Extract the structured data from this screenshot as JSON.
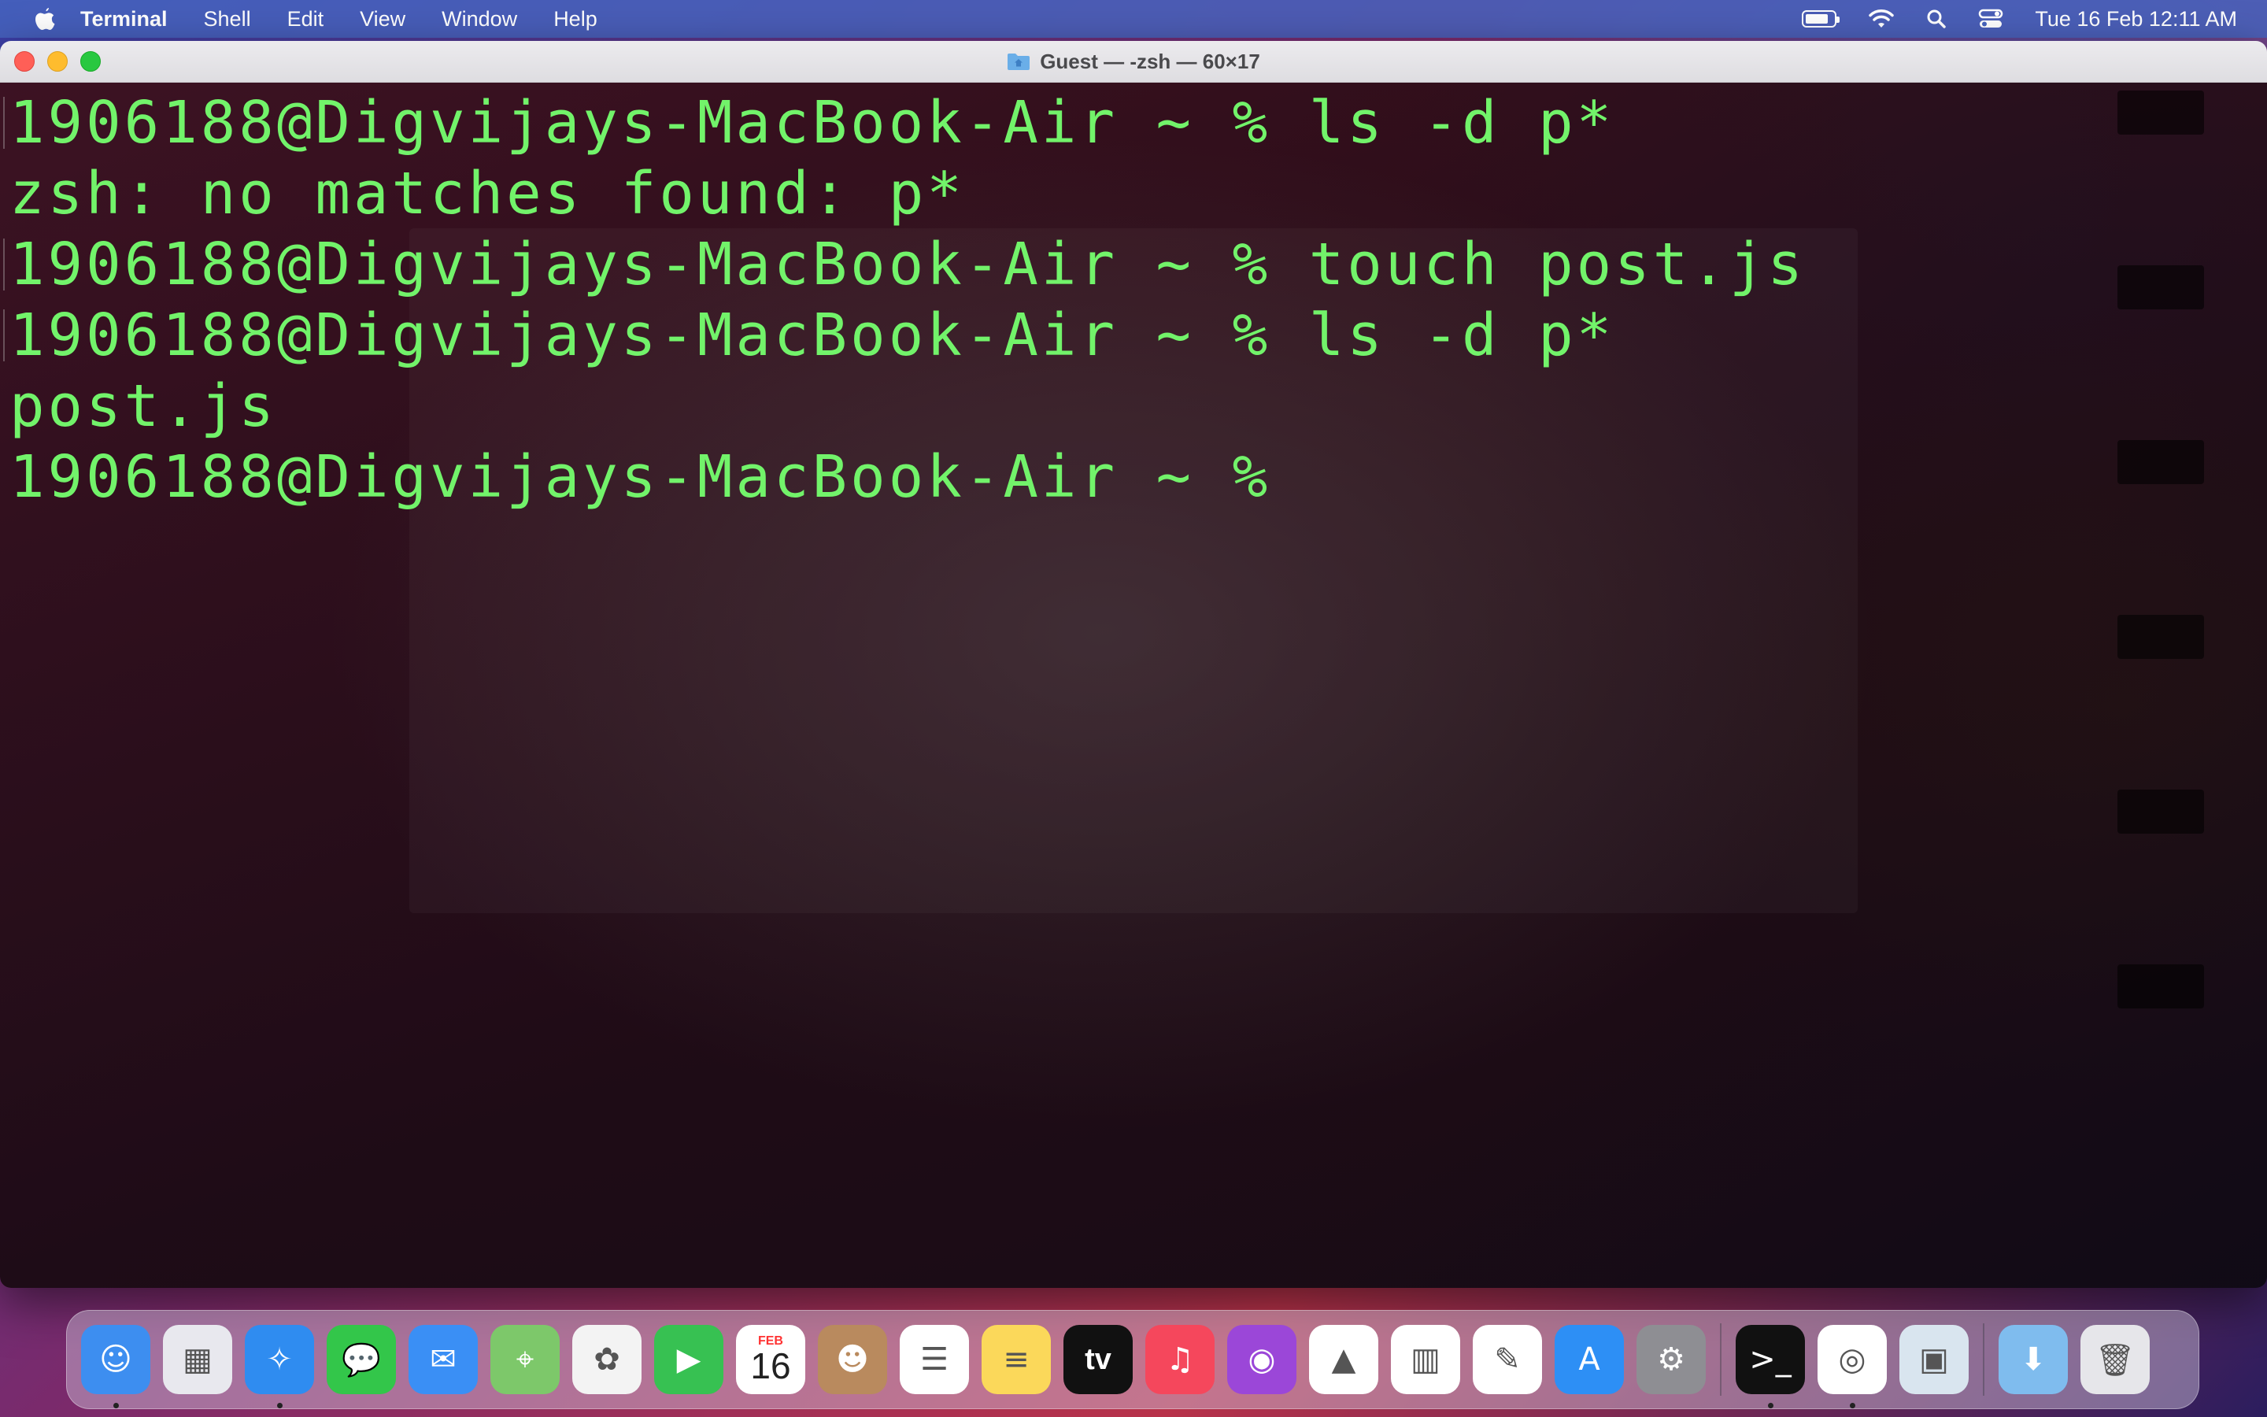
{
  "menubar": {
    "app_name": "Terminal",
    "items": [
      "Shell",
      "Edit",
      "View",
      "Window",
      "Help"
    ],
    "datetime": "Tue 16 Feb  12:11 AM"
  },
  "window": {
    "title": "Guest — -zsh — 60×17"
  },
  "terminal": {
    "lines": [
      "1906188@Digvijays-MacBook-Air ~ % ls -d p*",
      "zsh: no matches found: p*",
      "1906188@Digvijays-MacBook-Air ~ % touch post.js",
      "1906188@Digvijays-MacBook-Air ~ % ls -d p*",
      "post.js",
      "1906188@Digvijays-MacBook-Air ~ % "
    ],
    "text_color": "#72f36a"
  },
  "dock": {
    "apps": [
      {
        "name": "Finder",
        "icon": "finder-icon",
        "color": "#3d8ef0",
        "running": true
      },
      {
        "name": "Launchpad",
        "icon": "launchpad-icon",
        "color": "#e8e8ee",
        "running": false
      },
      {
        "name": "Safari",
        "icon": "safari-icon",
        "color": "#2f8cf0",
        "running": true
      },
      {
        "name": "Messages",
        "icon": "messages-icon",
        "color": "#33c64a",
        "running": false
      },
      {
        "name": "Mail",
        "icon": "mail-icon",
        "color": "#3a8ff5",
        "running": false
      },
      {
        "name": "Maps",
        "icon": "maps-icon",
        "color": "#7dc86a",
        "running": false
      },
      {
        "name": "Photos",
        "icon": "photos-icon",
        "color": "#f3f3f3",
        "running": false
      },
      {
        "name": "FaceTime",
        "icon": "facetime-icon",
        "color": "#37c152",
        "running": false
      },
      {
        "name": "Calendar",
        "icon": "calendar-icon",
        "color": "#ffffff",
        "running": false,
        "month": "FEB",
        "day": "16"
      },
      {
        "name": "Contacts",
        "icon": "contacts-icon",
        "color": "#b98a5e",
        "running": false
      },
      {
        "name": "Reminders",
        "icon": "reminders-icon",
        "color": "#ffffff",
        "running": false
      },
      {
        "name": "Notes",
        "icon": "notes-icon",
        "color": "#fbd85a",
        "running": false
      },
      {
        "name": "TV",
        "icon": "tv-icon",
        "color": "#111111",
        "running": false,
        "label": "tv"
      },
      {
        "name": "Music",
        "icon": "music-icon",
        "color": "#f5475c",
        "running": false
      },
      {
        "name": "Podcasts",
        "icon": "podcasts-icon",
        "color": "#9b47d8",
        "running": false
      },
      {
        "name": "Keynote",
        "icon": "keynote-icon",
        "color": "#ffffff",
        "running": false
      },
      {
        "name": "Numbers",
        "icon": "numbers-icon",
        "color": "#ffffff",
        "running": false
      },
      {
        "name": "Pages",
        "icon": "pages-icon",
        "color": "#ffffff",
        "running": false
      },
      {
        "name": "App Store",
        "icon": "app-store-icon",
        "color": "#2d8ff5",
        "running": false
      },
      {
        "name": "System Preferences",
        "icon": "system-preferences-icon",
        "color": "#8e8e93",
        "running": false
      }
    ],
    "apps_right": [
      {
        "name": "Terminal",
        "icon": "terminal-icon",
        "color": "#111111",
        "running": true
      },
      {
        "name": "Chrome",
        "icon": "chrome-icon",
        "color": "#ffffff",
        "running": true
      },
      {
        "name": "Preview",
        "icon": "preview-icon",
        "color": "#d9e5ef",
        "running": false
      }
    ],
    "apps_far_right": [
      {
        "name": "Downloads",
        "icon": "downloads-folder-icon",
        "color": "#7fbcee",
        "running": false
      },
      {
        "name": "Trash",
        "icon": "trash-icon",
        "color": "#e6e6ea",
        "running": false
      }
    ]
  }
}
